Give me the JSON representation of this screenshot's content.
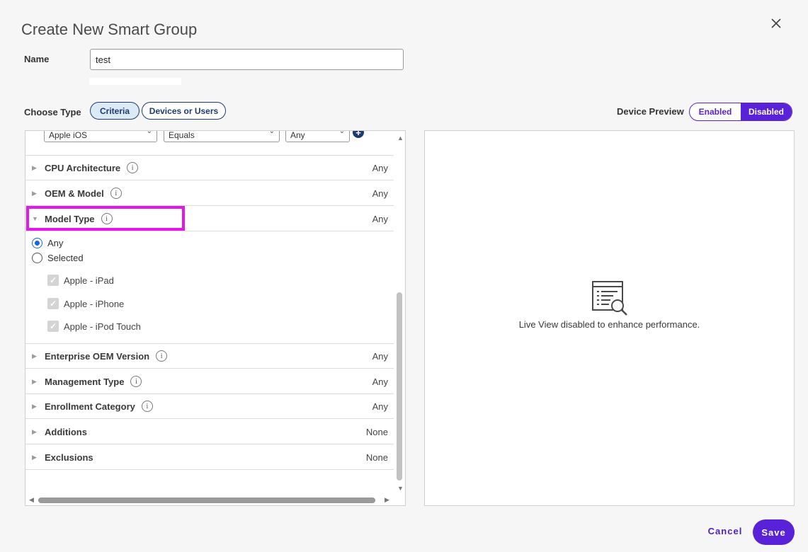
{
  "dialog": {
    "title": "Create New Smart Group"
  },
  "name": {
    "label": "Name",
    "value": "test"
  },
  "choose_type": {
    "label": "Choose Type",
    "options": [
      "Criteria",
      "Devices or Users"
    ],
    "selected": "Criteria"
  },
  "device_preview": {
    "label": "Device Preview",
    "options": [
      "Enabled",
      "Disabled"
    ],
    "selected": "Disabled"
  },
  "criteria_top": {
    "platform": "Apple iOS",
    "operator": "Equals",
    "version": "Any"
  },
  "criteria": [
    {
      "label": "CPU Architecture",
      "value": "Any",
      "info": true
    },
    {
      "label": "OEM & Model",
      "value": "Any",
      "info": true
    },
    {
      "label": "Model Type",
      "value": "Any",
      "info": true,
      "expanded": true
    },
    {
      "label": "Enterprise OEM Version",
      "value": "Any",
      "info": true
    },
    {
      "label": "Management Type",
      "value": "Any",
      "info": true
    },
    {
      "label": "Enrollment Category",
      "value": "Any",
      "info": true
    },
    {
      "label": "Additions",
      "value": "None",
      "info": false
    },
    {
      "label": "Exclusions",
      "value": "None",
      "info": false
    }
  ],
  "model_type": {
    "radios": [
      {
        "label": "Any",
        "checked": true
      },
      {
        "label": "Selected",
        "checked": false
      }
    ],
    "checkboxes": [
      "Apple - iPad",
      "Apple - iPhone",
      "Apple - iPod Touch"
    ]
  },
  "preview": {
    "message": "Live View disabled to enhance performance."
  },
  "footer": {
    "cancel": "Cancel",
    "save": "Save"
  },
  "colors": {
    "accent": "#5a22d8",
    "highlight": "#e018e8",
    "pill_border": "#1f3a73"
  }
}
